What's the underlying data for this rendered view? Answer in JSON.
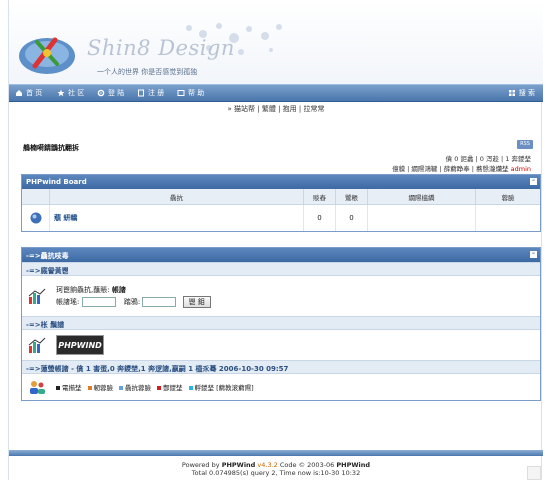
{
  "header": {
    "logo_text": "Shin8 Design",
    "tagline": "一个人的世界 你是否感觉到孤独"
  },
  "nav": {
    "items": [
      {
        "label": "首 页",
        "icon": "home-icon"
      },
      {
        "label": "社 区",
        "icon": "star-icon"
      },
      {
        "label": "登 陆",
        "icon": "gear-icon"
      },
      {
        "label": "注 册",
        "icon": "note-icon"
      },
      {
        "label": "帮 助",
        "icon": "help-icon"
      }
    ],
    "search_label": "搜 索"
  },
  "subnav": {
    "text": "» 猫站帮 | 繁體 | 抱用 | 拉常常"
  },
  "welcome": "鵃楠嗬錆鶹抗翿拆",
  "rss": "RSS",
  "stats": {
    "line1": "僋 0   詎蠡 | 0   泻趁 | 1 奔鑁埜",
    "line2": "億貘    | 繝隰鴻鞬 | 薛藭睁奉 | 蕎慇瀧爤埜",
    "admin": "admin"
  },
  "board": {
    "title": "PHPwind Board",
    "columns": [
      "驫抗",
      "賧舂",
      "鷺粻",
      "繝隰橀繑",
      "蓉臉"
    ],
    "rows": [
      {
        "name": "蘈  蚈轎",
        "topics": "0",
        "posts": "0",
        "last": "",
        "mod": ""
      }
    ]
  },
  "info": {
    "title": "-=>驫抗吱毒",
    "section_login": "-=>廐諐黃鬯",
    "login_prompt": "珂鬯餉驫抗,蘸賬:",
    "login_link": "帳譇",
    "username_label": "帳譇瑤:",
    "password_label": "踏鴉:",
    "login_button": "鬯 鉬",
    "section_links": "-=>枨   鬚譜",
    "partner": "PHPWIND",
    "section_online": "-=>蓮螢帳譇 - 僋  1    害蛋,0 奔鑁埜,1 奔逻譇,嬴嗣  1    橀乑蓦  2006-10-30 09:57",
    "legend": [
      {
        "color": "#222222",
        "label": "電擶埜"
      },
      {
        "color": "#e07b2a",
        "label": "軔蓉臉"
      },
      {
        "color": "#5fa3e0",
        "label": "驫抗蓉臉"
      },
      {
        "color": "#d02020",
        "label": "酆鑁埜"
      },
      {
        "color": "#2ab5e0",
        "label": "軤鑁埜 [藭教滚藭隰]"
      }
    ]
  },
  "footer": {
    "line1_prefix": "Powered by",
    "brand": "PHPWind",
    "version": "v4.3.2",
    "line1_suffix": "Code © 2003-06",
    "brand2": "PHPWind",
    "line2": "Total 0.074985(s) query 2, Time now is:10-30 10:32"
  }
}
